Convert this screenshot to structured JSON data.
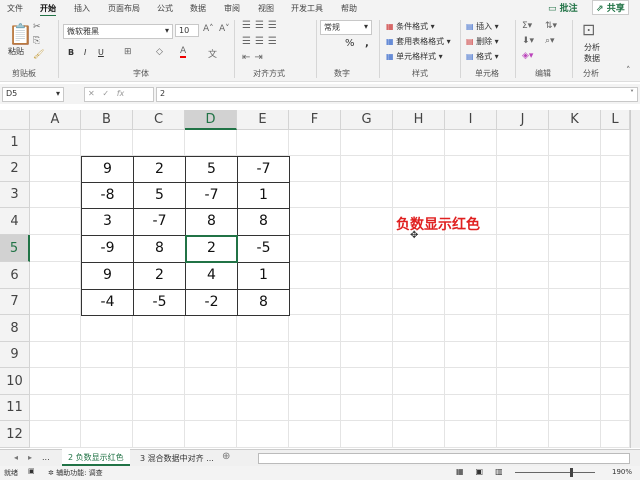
{
  "menu": [
    "文件",
    "开始",
    "插入",
    "页面布局",
    "公式",
    "数据",
    "审阅",
    "视图",
    "开发工具",
    "帮助"
  ],
  "comment_btn": "批注",
  "share_btn": "共享",
  "clipboard": {
    "paste": "粘贴",
    "label": "剪贴板"
  },
  "font": {
    "name": "微软雅黑",
    "size": "10",
    "bold": "B",
    "italic": "I",
    "underline": "U",
    "label": "字体"
  },
  "align": {
    "label": "对齐方式"
  },
  "number": {
    "format": "常规",
    "percent": "%",
    "comma": ",",
    "label": "数字"
  },
  "styles": {
    "cond": "条件格式",
    "table": "套用表格格式",
    "cell": "单元格样式",
    "label": "样式"
  },
  "cells": {
    "insert": "插入",
    "delete": "删除",
    "format": "格式",
    "label": "单元格"
  },
  "editing": {
    "label": "编辑"
  },
  "analysis": {
    "btn": "分析数据",
    "label": "分析"
  },
  "formula_bar": {
    "name_box": "D5",
    "fx": "fx",
    "value": "2"
  },
  "columns": [
    "A",
    "B",
    "C",
    "D",
    "E",
    "F",
    "G",
    "H",
    "I",
    "J",
    "K",
    "L"
  ],
  "rows": [
    "1",
    "2",
    "3",
    "4",
    "5",
    "6",
    "7",
    "8",
    "9",
    "10",
    "11",
    "12"
  ],
  "selected": {
    "col": "D",
    "row": "5"
  },
  "table": [
    [
      "9",
      "2",
      "5",
      "-7"
    ],
    [
      "-8",
      "5",
      "-7",
      "1"
    ],
    [
      "3",
      "-7",
      "8",
      "8"
    ],
    [
      "-9",
      "8",
      "2",
      "-5"
    ],
    [
      "9",
      "2",
      "4",
      "1"
    ],
    [
      "-4",
      "-5",
      "-2",
      "8"
    ]
  ],
  "note": {
    "text": "负数显示红色",
    "color": "#e02020"
  },
  "sheets": {
    "more": "...",
    "active": "2 负数显示红色",
    "other": "3 混合数据中对齐 ...",
    "more2": "..."
  },
  "status": {
    "ready": "就绪",
    "accessibility": "辅助功能: 调查",
    "zoom": "190%"
  },
  "accent": "#217346"
}
